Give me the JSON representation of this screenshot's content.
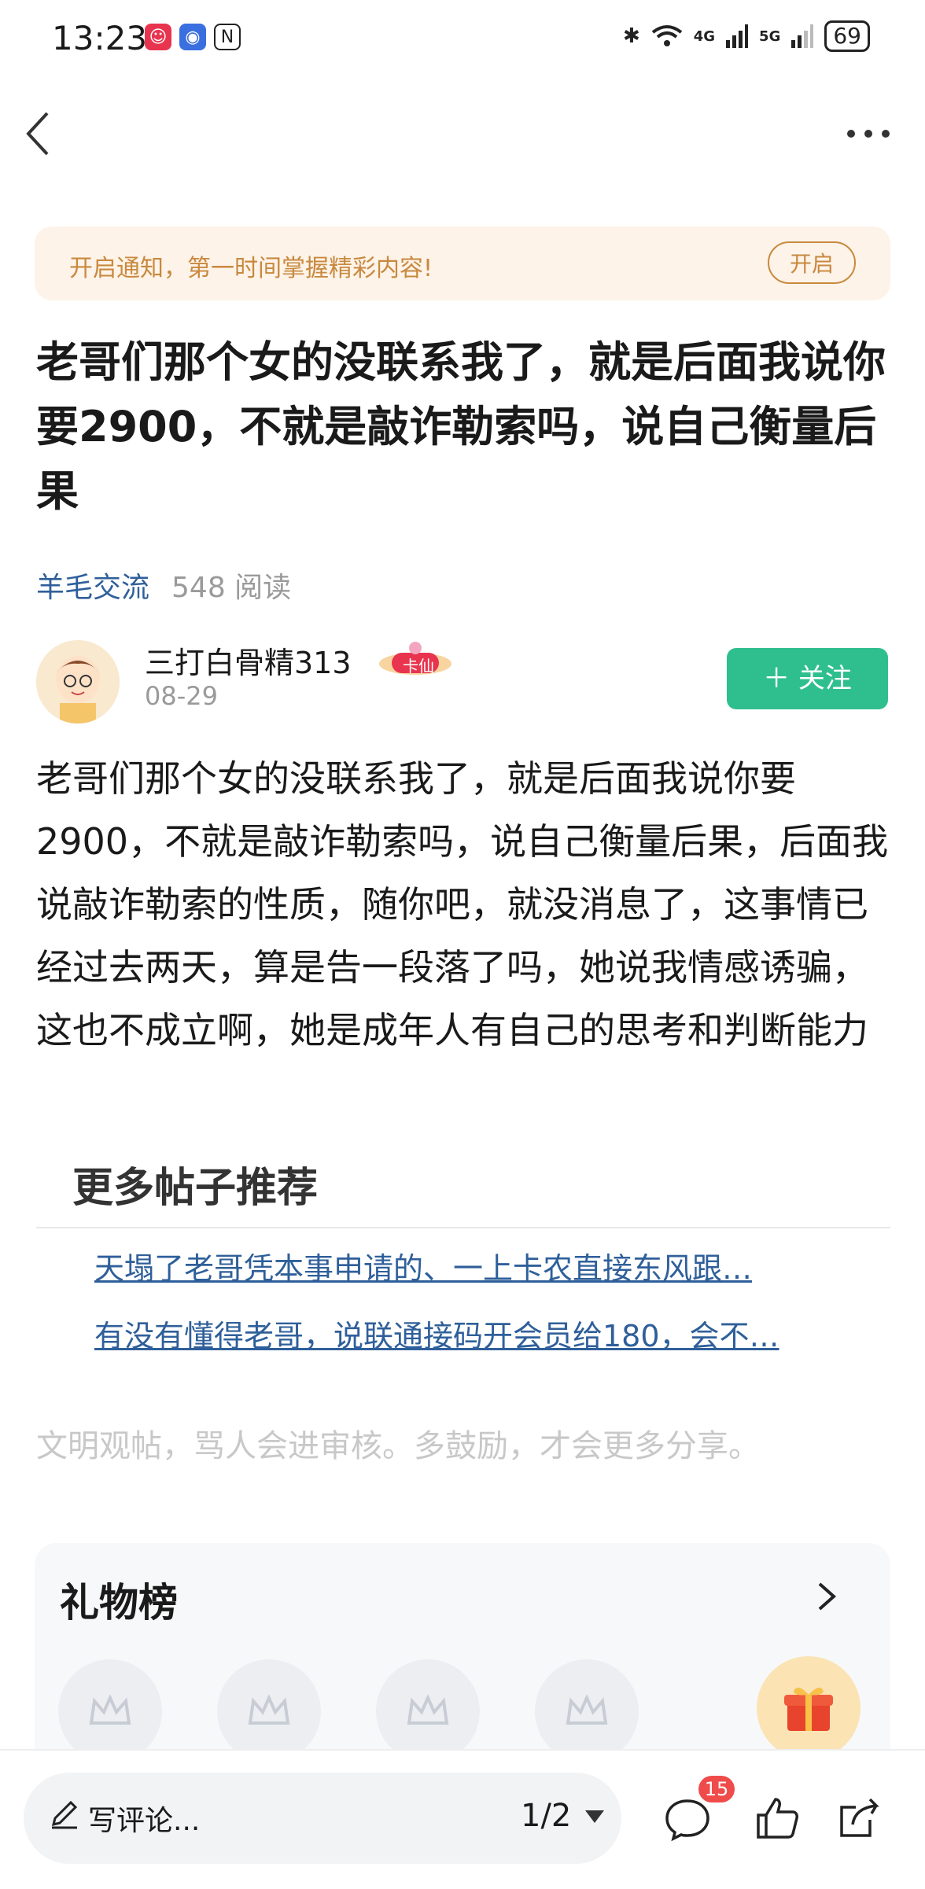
{
  "status_bar": {
    "time": "13:23",
    "battery": "69",
    "signal_4g": "4G",
    "signal_5g": "5G"
  },
  "notice": {
    "text": "开启通知，第一时间掌握精彩内容!",
    "button": "开启",
    "color": "#c8893f"
  },
  "post": {
    "title": "老哥们那个女的没联系我了，就是后面我说你要2900，不就是敲诈勒索吗，说自己衡量后果",
    "category": "羊毛交流",
    "reads": "548 阅读",
    "author": "三打白骨精313",
    "author_badge": "卡仙",
    "date": "08-29",
    "follow_label": "＋ 关注",
    "body": "老哥们那个女的没联系我了，就是后面我说你要2900，不就是敲诈勒索吗，说自己衡量后果，后面我说敲诈勒索的性质，随你吧，就没消息了，这事情已经过去两天，算是告一段落了吗，她说我情感诱骗，这也不成立啊，她是成年人有自己的思考和判断能力"
  },
  "recommend": {
    "title": "更多帖子推荐",
    "items": [
      "天塌了老哥凭本事申请的、一上卡农直接东风跟…",
      "有没有懂得老哥，说联通接码开会员给180，会不…"
    ]
  },
  "civil_notice": "文明观帖，骂人会进审核。多鼓励，才会更多分享。",
  "gift_board": {
    "title": "礼物榜"
  },
  "bottom_bar": {
    "comment_placeholder": "写评论...",
    "page_indicator": "1/2",
    "comment_count": "15"
  },
  "colors": {
    "accent_green": "#2fbf8f",
    "link_blue": "#2f5f9a",
    "badge_red": "#f04b4b"
  }
}
